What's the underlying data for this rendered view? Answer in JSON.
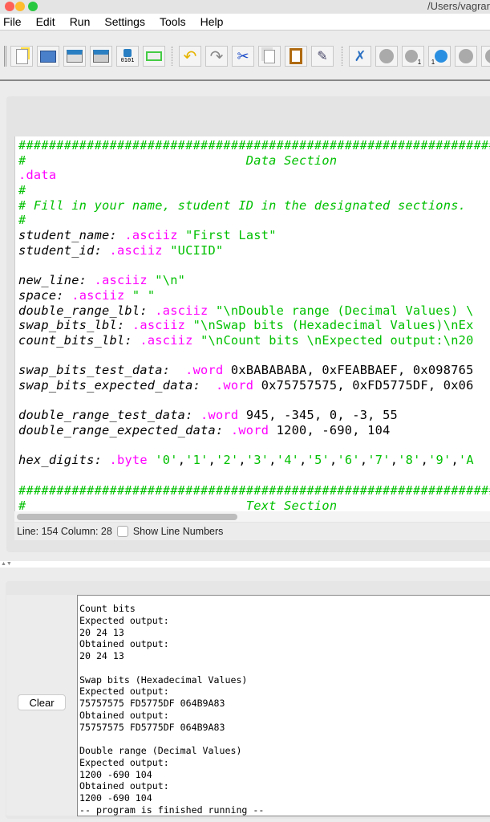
{
  "window": {
    "title": "/Users/vagrar"
  },
  "menu": [
    "File",
    "Edit",
    "Run",
    "Settings",
    "Tools",
    "Help"
  ],
  "toolbar": {
    "file_group": [
      "new-file",
      "open-file",
      "save-file",
      "save-as",
      "dump-memory",
      "print"
    ],
    "edit_group": [
      "undo",
      "redo",
      "cut",
      "copy",
      "paste",
      "find-replace"
    ],
    "run_group": [
      "assemble",
      "run",
      "step",
      "backstep",
      "pause",
      "stop"
    ],
    "dump_label": "0101",
    "step_label": "1",
    "backstep_label": "1"
  },
  "editor": {
    "lines": [
      [
        [
          "com",
          "####################################################################"
        ]
      ],
      [
        [
          "com",
          "#                             Data Section"
        ]
      ],
      [
        [
          "dir",
          ".data"
        ]
      ],
      [
        [
          "com",
          "#"
        ]
      ],
      [
        [
          "com",
          "# Fill in your name, student ID in the designated sections."
        ]
      ],
      [
        [
          "com",
          "#"
        ]
      ],
      [
        [
          "label",
          "student_name:"
        ],
        [
          "plain",
          " "
        ],
        [
          "dir",
          ".asciiz"
        ],
        [
          "plain",
          " "
        ],
        [
          "str",
          "\"First Last\""
        ]
      ],
      [
        [
          "label",
          "student_id:"
        ],
        [
          "plain",
          " "
        ],
        [
          "dir",
          ".asciiz"
        ],
        [
          "plain",
          " "
        ],
        [
          "str",
          "\"UCIID\""
        ]
      ],
      [],
      [
        [
          "label",
          "new_line:"
        ],
        [
          "plain",
          " "
        ],
        [
          "dir",
          ".asciiz"
        ],
        [
          "plain",
          " "
        ],
        [
          "str",
          "\"\\n\""
        ]
      ],
      [
        [
          "label",
          "space:"
        ],
        [
          "plain",
          " "
        ],
        [
          "dir",
          ".asciiz"
        ],
        [
          "plain",
          " "
        ],
        [
          "str",
          "\" \""
        ]
      ],
      [
        [
          "label",
          "double_range_lbl:"
        ],
        [
          "plain",
          " "
        ],
        [
          "dir",
          ".asciiz"
        ],
        [
          "plain",
          " "
        ],
        [
          "str",
          "\"\\nDouble range (Decimal Values) \\"
        ]
      ],
      [
        [
          "label",
          "swap_bits_lbl:"
        ],
        [
          "plain",
          " "
        ],
        [
          "dir",
          ".asciiz"
        ],
        [
          "plain",
          " "
        ],
        [
          "str",
          "\"\\nSwap bits (Hexadecimal Values)\\nEx"
        ]
      ],
      [
        [
          "label",
          "count_bits_lbl:"
        ],
        [
          "plain",
          " "
        ],
        [
          "dir",
          ".asciiz"
        ],
        [
          "plain",
          " "
        ],
        [
          "str",
          "\"\\nCount bits \\nExpected output:\\n20"
        ]
      ],
      [],
      [
        [
          "label",
          "swap_bits_test_data:"
        ],
        [
          "plain",
          "  "
        ],
        [
          "dir",
          ".word"
        ],
        [
          "num",
          " 0xBABABABA, 0xFEABBAEF, 0x098765"
        ]
      ],
      [
        [
          "label",
          "swap_bits_expected_data:"
        ],
        [
          "plain",
          "  "
        ],
        [
          "dir",
          ".word"
        ],
        [
          "num",
          " 0x75757575, 0xFD5775DF, 0x06"
        ]
      ],
      [],
      [
        [
          "label",
          "double_range_test_data:"
        ],
        [
          "plain",
          " "
        ],
        [
          "dir",
          ".word"
        ],
        [
          "num",
          " 945, -345, 0, -3, 55"
        ]
      ],
      [
        [
          "label",
          "double_range_expected_data:"
        ],
        [
          "plain",
          " "
        ],
        [
          "dir",
          ".word"
        ],
        [
          "num",
          " 1200, -690, 104"
        ]
      ],
      [],
      [
        [
          "label",
          "hex_digits:"
        ],
        [
          "plain",
          " "
        ],
        [
          "dir",
          ".byte"
        ],
        [
          "plain",
          " "
        ],
        [
          "str",
          "'0'"
        ],
        [
          "plain",
          ","
        ],
        [
          "str",
          "'1'"
        ],
        [
          "plain",
          ","
        ],
        [
          "str",
          "'2'"
        ],
        [
          "plain",
          ","
        ],
        [
          "str",
          "'3'"
        ],
        [
          "plain",
          ","
        ],
        [
          "str",
          "'4'"
        ],
        [
          "plain",
          ","
        ],
        [
          "str",
          "'5'"
        ],
        [
          "plain",
          ","
        ],
        [
          "str",
          "'6'"
        ],
        [
          "plain",
          ","
        ],
        [
          "str",
          "'7'"
        ],
        [
          "plain",
          ","
        ],
        [
          "str",
          "'8'"
        ],
        [
          "plain",
          ","
        ],
        [
          "str",
          "'9'"
        ],
        [
          "plain",
          ","
        ],
        [
          "str",
          "'A"
        ]
      ],
      [],
      [
        [
          "com",
          "####################################################################"
        ]
      ],
      [
        [
          "com",
          "#                             Text Section"
        ]
      ]
    ],
    "status": "Line: 154 Column: 28",
    "show_line_numbers_label": "Show Line Numbers",
    "show_line_numbers_checked": false
  },
  "output": {
    "clear_label": "Clear",
    "text": "Count bits\nExpected output:\n20 24 13\nObtained output:\n20 24 13\n\nSwap bits (Hexadecimal Values)\nExpected output:\n75757575 FD5775DF 064B9A83\nObtained output:\n75757575 FD5775DF 064B9A83\n\nDouble range (Decimal Values)\nExpected output:\n1200 -690 104\nObtained output:\n1200 -690 104\n-- program is finished running --"
  },
  "colors": {
    "comment": "#00c000",
    "directive": "#ff00ff",
    "text": "#000000"
  }
}
